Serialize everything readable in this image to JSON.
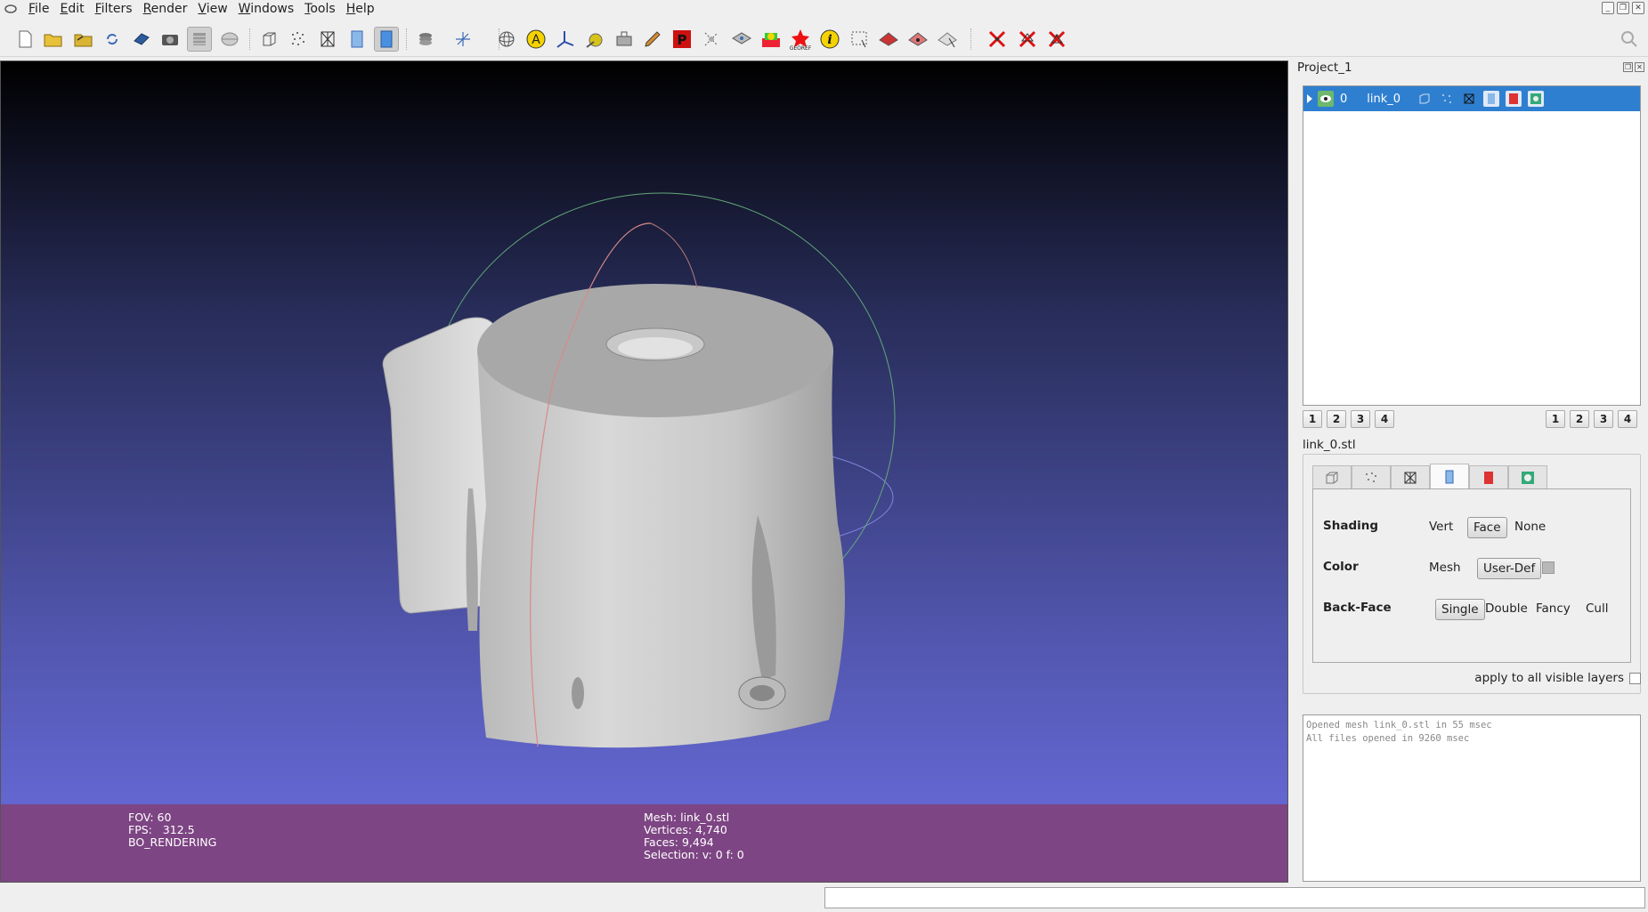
{
  "menu": [
    "File",
    "Edit",
    "Filters",
    "Render",
    "View",
    "Windows",
    "Tools",
    "Help"
  ],
  "toolbar_icons": [
    "new-project",
    "open-project",
    "open-mesh",
    "reload",
    "save-snapshot",
    "snapshot",
    "layer-toggle",
    "toggle",
    "bounding-box",
    "points",
    "wireframe",
    "flat-lines",
    "flat",
    "layers",
    "axis",
    "sphere-trackball",
    "annotation-a",
    "measure-axis",
    "paint-brush",
    "point-picker",
    "pencil",
    "paraview",
    "edit-points",
    "align",
    "color-blend",
    "georef",
    "info",
    "select-region",
    "select-faces",
    "select-vertices",
    "select-connected",
    "delete-vertices",
    "delete-faces",
    "delete-faces-vertices"
  ],
  "viewport": {
    "info_left": [
      "FOV: 60",
      "FPS:   312.5",
      "BO_RENDERING"
    ],
    "info_right": [
      "Mesh: link_0.stl",
      "Vertices: 4,740",
      "Faces: 9,494",
      "Selection: v: 0 f: 0"
    ]
  },
  "panel": {
    "title": "Project_1",
    "layer": {
      "index": "0",
      "name": "link_0"
    },
    "left_nums": [
      "1",
      "2",
      "3",
      "4"
    ],
    "right_nums": [
      "1",
      "2",
      "3",
      "4"
    ],
    "mesh_name": "link_0.stl",
    "shading": {
      "label": "Shading",
      "options": [
        "Vert",
        "Face",
        "None"
      ],
      "selected": "Face"
    },
    "color": {
      "label": "Color",
      "options": [
        "Mesh",
        "User-Def"
      ],
      "selected": "User-Def",
      "swatch": "#b8b8b8"
    },
    "backface": {
      "label": "Back-Face",
      "options": [
        "Single",
        "Double",
        "Fancy",
        "Cull"
      ],
      "selected": "Single"
    },
    "apply_all": "apply to all visible layers",
    "log": [
      "Opened mesh link_0.stl in 55 msec",
      "All files opened in 9260 msec"
    ]
  }
}
